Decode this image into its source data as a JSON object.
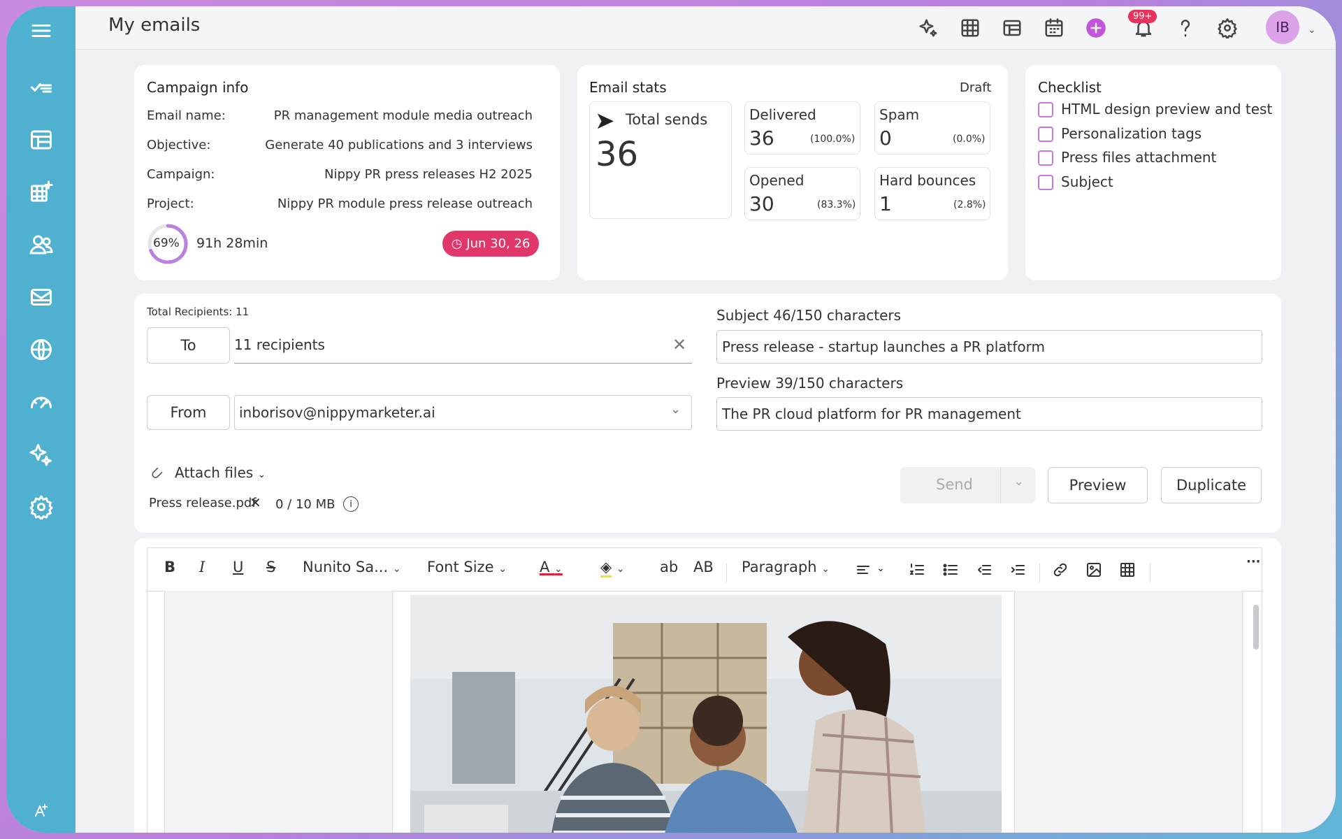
{
  "header": {
    "title": "My emails",
    "notifications_badge": "99+",
    "avatar_initials": "IB"
  },
  "campaign_info": {
    "title": "Campaign info",
    "rows": [
      {
        "label": "Email name:",
        "value": "PR management module media outreach"
      },
      {
        "label": "Objective:",
        "value": "Generate 40 publications and 3 interviews"
      },
      {
        "label": "Campaign:",
        "value": "Nippy PR press releases H2 2025"
      },
      {
        "label": "Project:",
        "value": "Nippy PR module press release outreach"
      }
    ],
    "progress_percent": 69,
    "progress_label": "69%",
    "time_spent": "91h 28min",
    "due_date": "Jun 30, 26"
  },
  "email_stats": {
    "title": "Email stats",
    "status": "Draft",
    "total_sends_label": "Total sends",
    "total_sends": "36",
    "boxes": [
      {
        "label": "Delivered",
        "value": "36",
        "pct": "(100.0%)"
      },
      {
        "label": "Spam",
        "value": "0",
        "pct": "(0.0%)"
      },
      {
        "label": "Opened",
        "value": "30",
        "pct": "(83.3%)"
      },
      {
        "label": "Hard bounces",
        "value": "1",
        "pct": "(2.8%)"
      }
    ]
  },
  "checklist": {
    "title": "Checklist",
    "items": [
      "HTML design preview and test",
      "Personalization tags",
      "Press files attachment",
      "Subject"
    ]
  },
  "compose": {
    "total_recipients": "Total Recipients: 11",
    "to_label": "To",
    "to_value": "11 recipients",
    "from_label": "From",
    "from_value": "inborisov@nippymarketer.ai",
    "subject_label": "Subject 46/150 characters",
    "subject_value": "Press release - startup launches a PR platform",
    "preview_label": "Preview 39/150 characters",
    "preview_value": "The PR cloud platform for PR management",
    "attach_label": "Attach files",
    "attachment_name": "Press release.pdf",
    "attachment_size": "0 / 10 MB",
    "send_label": "Send",
    "preview_button": "Preview",
    "duplicate_button": "Duplicate"
  },
  "editor": {
    "font_name": "Nunito Sa...",
    "font_size": "Font Size",
    "paragraph": "Paragraph",
    "case_lower": "ab",
    "case_upper": "AB",
    "bold": "B",
    "italic": "I",
    "underline": "U",
    "strike": "S",
    "more": "···"
  },
  "colors": {
    "sidebar": "#4fb0cf",
    "accent": "#c57ad9",
    "danger": "#e0386a"
  }
}
